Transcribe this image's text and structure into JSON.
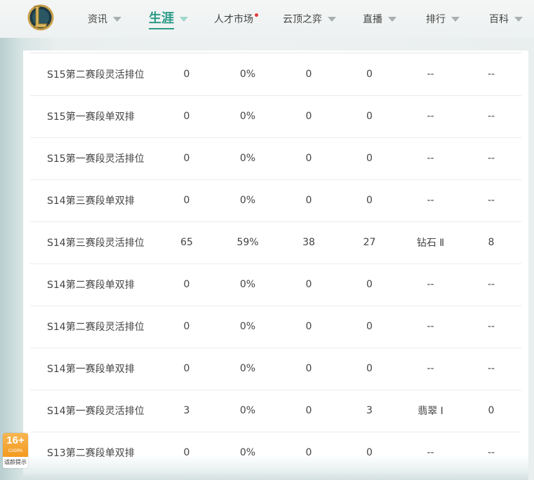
{
  "nav": {
    "items": [
      {
        "label": "资讯",
        "has_caret": true
      },
      {
        "label": "生涯",
        "has_caret": true,
        "active": true
      },
      {
        "label": "人才市场",
        "has_dot": true
      },
      {
        "label": "云顶之弈",
        "has_caret": true
      },
      {
        "label": "直播",
        "has_caret": true
      },
      {
        "label": "排行",
        "has_caret": true
      },
      {
        "label": "百科",
        "has_caret": true
      }
    ],
    "logo_icon": "league-of-legends-logo-icon",
    "accent_color": "#2c9b87",
    "dot_color": "#e53a3a"
  },
  "table": {
    "rows": [
      [
        "S15第二赛段灵活排位",
        "0",
        "0%",
        "0",
        "0",
        "--",
        "--"
      ],
      [
        "S15第一赛段单双排",
        "0",
        "0%",
        "0",
        "0",
        "--",
        "--"
      ],
      [
        "S15第一赛段灵活排位",
        "0",
        "0%",
        "0",
        "0",
        "--",
        "--"
      ],
      [
        "S14第三赛段单双排",
        "0",
        "0%",
        "0",
        "0",
        "--",
        "--"
      ],
      [
        "S14第三赛段灵活排位",
        "65",
        "59%",
        "38",
        "27",
        "钻石 Ⅱ",
        "8"
      ],
      [
        "S14第二赛段单双排",
        "0",
        "0%",
        "0",
        "0",
        "--",
        "--"
      ],
      [
        "S14第二赛段灵活排位",
        "0",
        "0%",
        "0",
        "0",
        "--",
        "--"
      ],
      [
        "S14第一赛段单双排",
        "0",
        "0%",
        "0",
        "0",
        "--",
        "--"
      ],
      [
        "S14第一赛段灵活排位",
        "3",
        "0%",
        "0",
        "3",
        "翡翠 Ⅰ",
        "0"
      ],
      [
        "S13第二赛段单双排",
        "0",
        "0%",
        "0",
        "0",
        "--",
        "--"
      ]
    ]
  },
  "age_badge": {
    "number": "16+",
    "org": "CADPA",
    "tip": "适龄提示",
    "color": "#f39a1f"
  }
}
